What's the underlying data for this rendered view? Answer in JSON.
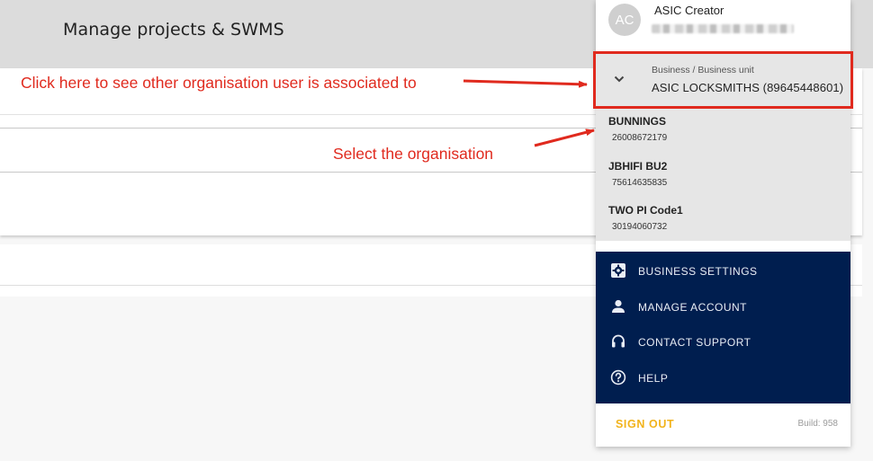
{
  "header": {
    "title": "Manage projects & SWMS"
  },
  "user": {
    "initials": "AC",
    "name": "ASIC Creator"
  },
  "business_select": {
    "label": "Business / Business unit",
    "value": "ASIC LOCKSMITHS (89645448601)"
  },
  "organisations": [
    {
      "name": "BUNNINGS",
      "number": "26008672179"
    },
    {
      "name": "JBHIFI BU2",
      "number": "75614635835"
    },
    {
      "name": "TWO PI Code1",
      "number": "30194060732"
    }
  ],
  "menu": [
    {
      "label": "BUSINESS SETTINGS",
      "icon": "gear-icon"
    },
    {
      "label": "MANAGE ACCOUNT",
      "icon": "person-icon"
    },
    {
      "label": "CONTACT SUPPORT",
      "icon": "headset-icon"
    },
    {
      "label": "HELP",
      "icon": "help-circle-icon"
    }
  ],
  "footer": {
    "sign_out": "SIGN OUT",
    "build": "Build: 958"
  },
  "annotations": {
    "dropdown_hint": "Click here to see other organisation user is associated to",
    "select_hint": "Select the organisation"
  },
  "colors": {
    "annotation": "#e02a1e",
    "nav_background": "#001e4f",
    "sign_out": "#f2b31b",
    "header_background": "#dcdcdc"
  }
}
